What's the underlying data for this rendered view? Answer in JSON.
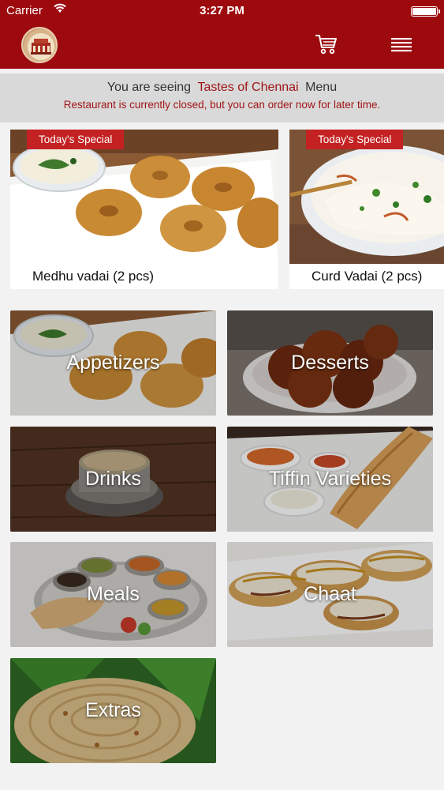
{
  "status_bar": {
    "carrier": "Carrier",
    "time": "3:27 PM"
  },
  "colors": {
    "brand": "#9d0a0e",
    "tag": "#c32122",
    "accent_text": "#a01517",
    "banner_bg": "#d9d9d9"
  },
  "nav": {
    "logo": "restaurant-logo",
    "cart_icon": "cart-icon",
    "menu_icon": "hamburger-icon"
  },
  "banner": {
    "prefix": "You are seeing",
    "restaurant": "Tastes of Chennai",
    "suffix": "Menu",
    "notice": "Restaurant is currently closed, but you can order now for later time."
  },
  "specials": [
    {
      "tag": "Today's Special",
      "name": "Medhu vadai (2 pcs)"
    },
    {
      "tag": "Today's Special",
      "name": "Curd Vadai (2 pcs)"
    }
  ],
  "categories": [
    {
      "label": "Appetizers"
    },
    {
      "label": "Desserts"
    },
    {
      "label": "Drinks"
    },
    {
      "label": "Tiffin Varieties"
    },
    {
      "label": "Meals"
    },
    {
      "label": "Chaat"
    },
    {
      "label": "Extras"
    }
  ]
}
